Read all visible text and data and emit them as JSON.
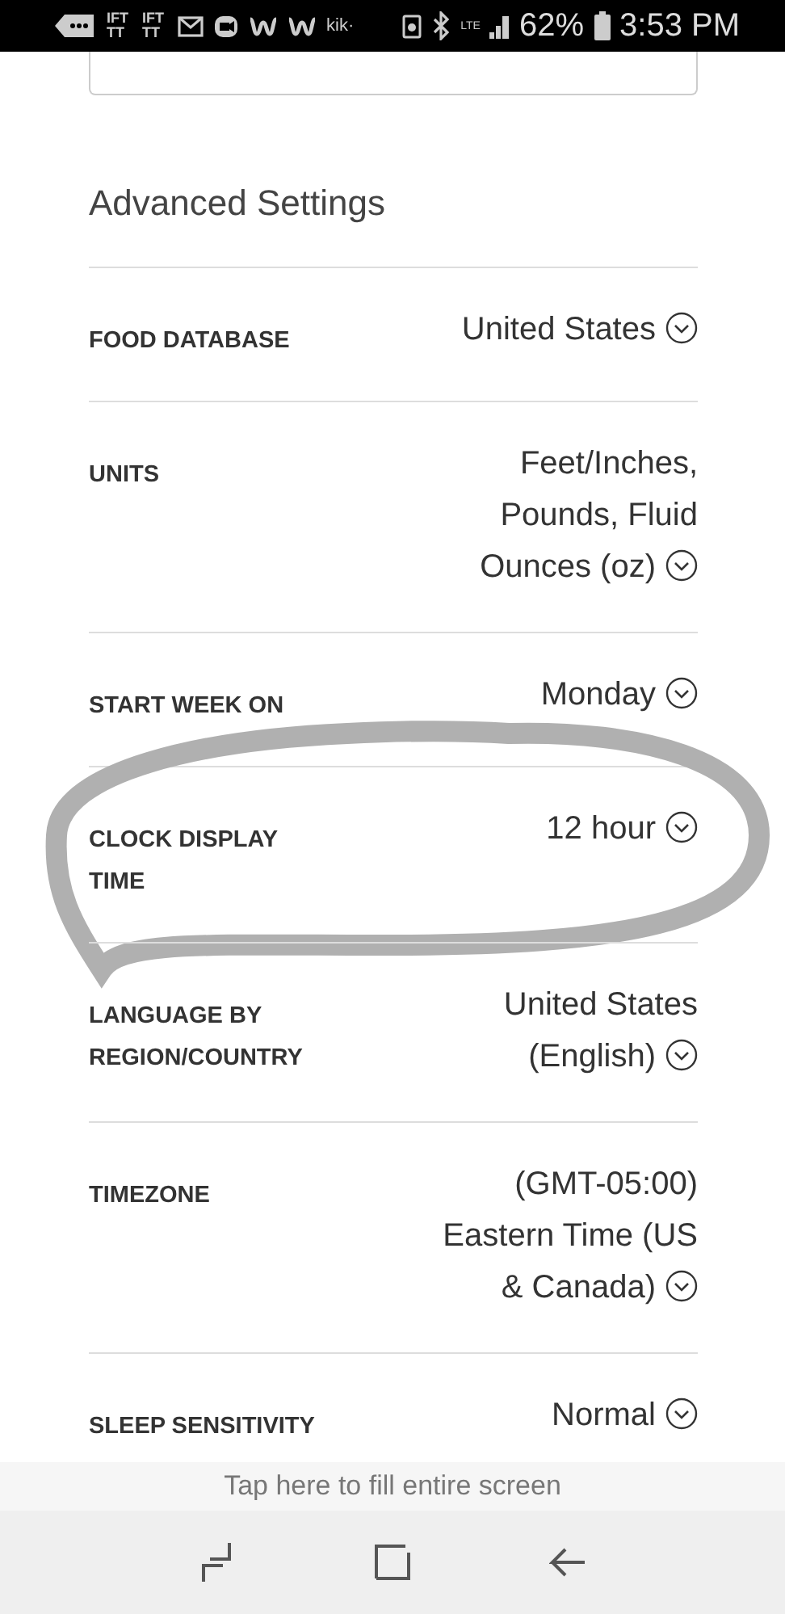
{
  "status_bar": {
    "notifications": [
      {
        "kind": "more"
      },
      {
        "kind": "text",
        "label": "IFT TT"
      },
      {
        "kind": "text",
        "label": "IFT TT"
      },
      {
        "kind": "mail"
      },
      {
        "kind": "chat"
      },
      {
        "kind": "w"
      },
      {
        "kind": "w"
      },
      {
        "kind": "text",
        "label": "kik·"
      }
    ],
    "battery_percent": "62%",
    "time": "3:53 PM",
    "network": "LTE"
  },
  "section_title": "Advanced Settings",
  "settings": [
    {
      "label": "FOOD DATABASE",
      "value": "United States"
    },
    {
      "label": "UNITS",
      "value": "Feet/Inches, Pounds, Fluid Ounces (oz)"
    },
    {
      "label": "START WEEK ON",
      "value": "Monday"
    },
    {
      "label": "CLOCK DISPLAY TIME",
      "value": "12 hour",
      "circled": true
    },
    {
      "label": "LANGUAGE BY REGION/COUNTRY",
      "value": "United States (English)"
    },
    {
      "label": "TIMEZONE",
      "value": "(GMT-05:00) Eastern Time (US & Canada)"
    },
    {
      "label": "SLEEP SENSITIVITY",
      "value": "Normal"
    }
  ],
  "overlay_hint": "Tap here to fill entire screen"
}
